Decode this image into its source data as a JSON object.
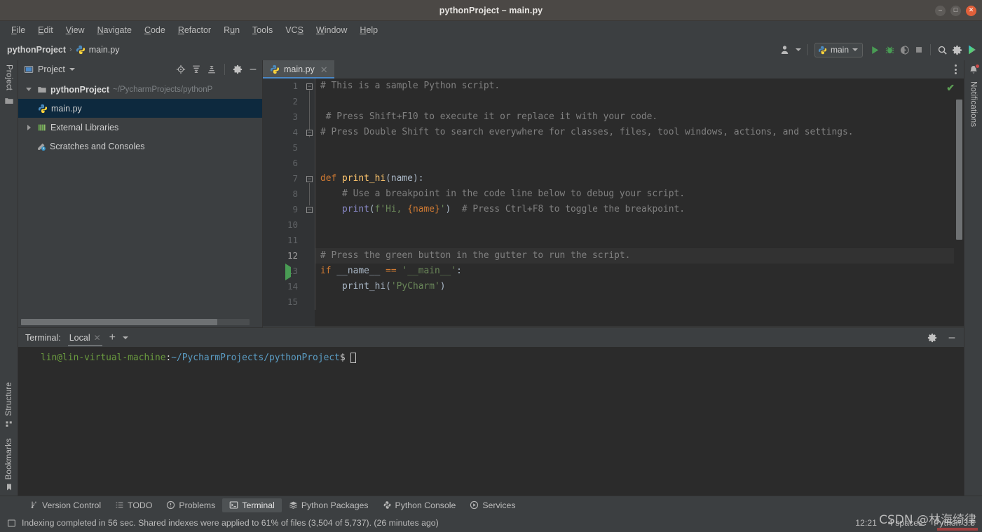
{
  "window": {
    "title": "pythonProject – main.py",
    "controls": {
      "minimize": "–",
      "maximize": "□",
      "close": "✕"
    }
  },
  "menubar": {
    "items": [
      {
        "label": "File",
        "mnemonic": "F"
      },
      {
        "label": "Edit",
        "mnemonic": "E"
      },
      {
        "label": "View",
        "mnemonic": "V"
      },
      {
        "label": "Navigate",
        "mnemonic": "N"
      },
      {
        "label": "Code",
        "mnemonic": "C"
      },
      {
        "label": "Refactor",
        "mnemonic": "R"
      },
      {
        "label": "Run",
        "mnemonic": "u"
      },
      {
        "label": "Tools",
        "mnemonic": "T"
      },
      {
        "label": "VCS",
        "mnemonic": "S"
      },
      {
        "label": "Window",
        "mnemonic": "W"
      },
      {
        "label": "Help",
        "mnemonic": "H"
      }
    ]
  },
  "navbar": {
    "breadcrumb": {
      "project": "pythonProject",
      "separator": "›",
      "file": "main.py"
    },
    "run_config": {
      "label": "main"
    },
    "icons": {
      "account": "account-icon",
      "run": "run-icon",
      "debug": "debug-icon",
      "coverage": "coverage-icon",
      "stop": "stop-icon",
      "search": "search-icon",
      "settings": "gear-icon",
      "assistant": "ai-assistant-icon"
    }
  },
  "left_rail": {
    "top": [
      {
        "label": "Project"
      }
    ],
    "bottom": [
      {
        "label": "Structure"
      },
      {
        "label": "Bookmarks"
      }
    ]
  },
  "right_rail": {
    "items": [
      {
        "label": "Notifications"
      }
    ]
  },
  "project_panel": {
    "title": "Project",
    "actions": [
      "locate-icon",
      "expand-all-icon",
      "collapse-all-icon",
      "gear-icon",
      "minimize-icon"
    ],
    "tree": [
      {
        "name": "pythonProject",
        "path": "~/PycharmProjects/pythonP",
        "type": "folder",
        "expanded": true,
        "selected": false,
        "level": 0
      },
      {
        "name": "main.py",
        "path": "",
        "type": "python-file",
        "expanded": null,
        "selected": true,
        "level": 1
      },
      {
        "name": "External Libraries",
        "path": "",
        "type": "libraries",
        "expanded": false,
        "selected": false,
        "level": 0
      },
      {
        "name": "Scratches and Consoles",
        "path": "",
        "type": "scratches",
        "expanded": null,
        "selected": false,
        "level": 0
      }
    ]
  },
  "editor": {
    "tab": {
      "label": "main.py",
      "close": "✕",
      "icon": "python-file-icon"
    },
    "inspection_status": "✔",
    "lines": [
      {
        "n": 1,
        "tokens": [
          {
            "t": "# This is a sample Python script.",
            "c": "cmt"
          }
        ],
        "indent": 0,
        "fold": "start",
        "highlight": false,
        "gutter": ""
      },
      {
        "n": 2,
        "tokens": [],
        "indent": 0,
        "fold": "",
        "highlight": false,
        "gutter": ""
      },
      {
        "n": 3,
        "tokens": [
          {
            "t": " # Press Shift+F10 to execute it or replace it with your code.",
            "c": "cmt"
          }
        ],
        "indent": 0,
        "fold": "",
        "highlight": false,
        "gutter": ""
      },
      {
        "n": 4,
        "tokens": [
          {
            "t": "# Press Double Shift to search everywhere for classes, files, tool windows, actions, and settings.",
            "c": "cmt"
          }
        ],
        "indent": 0,
        "fold": "end",
        "highlight": false,
        "gutter": ""
      },
      {
        "n": 5,
        "tokens": [],
        "indent": 0,
        "fold": "",
        "highlight": false,
        "gutter": ""
      },
      {
        "n": 6,
        "tokens": [],
        "indent": 0,
        "fold": "",
        "highlight": false,
        "gutter": ""
      },
      {
        "n": 7,
        "tokens": [
          {
            "t": "def ",
            "c": "kw"
          },
          {
            "t": "print_hi",
            "c": "fn"
          },
          {
            "t": "(name):",
            "c": "pun"
          }
        ],
        "indent": 0,
        "fold": "start",
        "highlight": false,
        "gutter": ""
      },
      {
        "n": 8,
        "tokens": [
          {
            "t": "    # Use a breakpoint in the code line below to debug your script.",
            "c": "cmt"
          }
        ],
        "indent": 0,
        "fold": "",
        "highlight": false,
        "gutter": ""
      },
      {
        "n": 9,
        "tokens": [
          {
            "t": "    ",
            "c": "pun"
          },
          {
            "t": "print",
            "c": "bif"
          },
          {
            "t": "(",
            "c": "pun"
          },
          {
            "t": "f'Hi, ",
            "c": "str"
          },
          {
            "t": "{name}",
            "c": "kw"
          },
          {
            "t": "'",
            "c": "str"
          },
          {
            "t": ")",
            "c": "pun"
          },
          {
            "t": "  # Press Ctrl+F8 to toggle the breakpoint.",
            "c": "cmt"
          }
        ],
        "indent": 0,
        "fold": "end",
        "highlight": false,
        "gutter": ""
      },
      {
        "n": 10,
        "tokens": [],
        "indent": 0,
        "fold": "",
        "highlight": false,
        "gutter": ""
      },
      {
        "n": 11,
        "tokens": [],
        "indent": 0,
        "fold": "",
        "highlight": false,
        "gutter": ""
      },
      {
        "n": 12,
        "tokens": [
          {
            "t": "# Press the green button in the gutter to run the script.",
            "c": "cmt"
          }
        ],
        "indent": 0,
        "fold": "",
        "highlight": true,
        "gutter": ""
      },
      {
        "n": 13,
        "tokens": [
          {
            "t": "if ",
            "c": "kw"
          },
          {
            "t": "__name__ ",
            "c": "ident"
          },
          {
            "t": "== ",
            "c": "kw"
          },
          {
            "t": "'__main__'",
            "c": "str"
          },
          {
            "t": ":",
            "c": "pun"
          }
        ],
        "indent": 0,
        "fold": "",
        "highlight": false,
        "gutter": "run"
      },
      {
        "n": 14,
        "tokens": [
          {
            "t": "    ",
            "c": "pun"
          },
          {
            "t": "print_hi",
            "c": "ident"
          },
          {
            "t": "(",
            "c": "pun"
          },
          {
            "t": "'PyCharm'",
            "c": "str"
          },
          {
            "t": ")",
            "c": "pun"
          }
        ],
        "indent": 0,
        "fold": "",
        "highlight": false,
        "gutter": ""
      },
      {
        "n": 15,
        "tokens": [],
        "indent": 0,
        "fold": "",
        "highlight": false,
        "gutter": ""
      }
    ]
  },
  "terminal": {
    "title": "Terminal:",
    "tab": {
      "label": "Local",
      "close": "✕"
    },
    "add_label": "+",
    "actions": [
      "gear-icon",
      "minimize-icon"
    ],
    "prompt": {
      "user_host": "lin@lin-virtual-machine",
      "colon": ":",
      "path": "~/PycharmProjects/pythonProject",
      "dollar": "$"
    }
  },
  "bottom_toolwindows": [
    {
      "label": "Version Control",
      "icon": "branch-icon",
      "active": false
    },
    {
      "label": "TODO",
      "icon": "list-icon",
      "active": false
    },
    {
      "label": "Problems",
      "icon": "warning-icon",
      "active": false
    },
    {
      "label": "Terminal",
      "icon": "terminal-icon",
      "active": true
    },
    {
      "label": "Python Packages",
      "icon": "packages-icon",
      "active": false
    },
    {
      "label": "Python Console",
      "icon": "python-console-icon",
      "active": false
    },
    {
      "label": "Services",
      "icon": "services-icon",
      "active": false
    }
  ],
  "statusbar": {
    "message": "Indexing completed in 56 sec. Shared indexes were applied to 61% of files (3,504 of 5,737). (26 minutes ago)",
    "icon": "info-icon",
    "time": "12:21",
    "indent": "4 spaces",
    "interpreter": "Python 3.8",
    "watermark": "CSDN @林海绮律"
  },
  "colors": {
    "accent_blue": "#4a88c7",
    "selection_blue": "#0d293e",
    "keyword_orange": "#cc7832",
    "string_green": "#6a8759",
    "function_yellow": "#ffc66d",
    "comment_gray": "#808080",
    "builtin_purple": "#8888c6",
    "run_green": "#499c54",
    "panel_bg": "#3c3f41",
    "editor_bg": "#2b2b2b",
    "titlebar_bg": "#4b4845"
  }
}
